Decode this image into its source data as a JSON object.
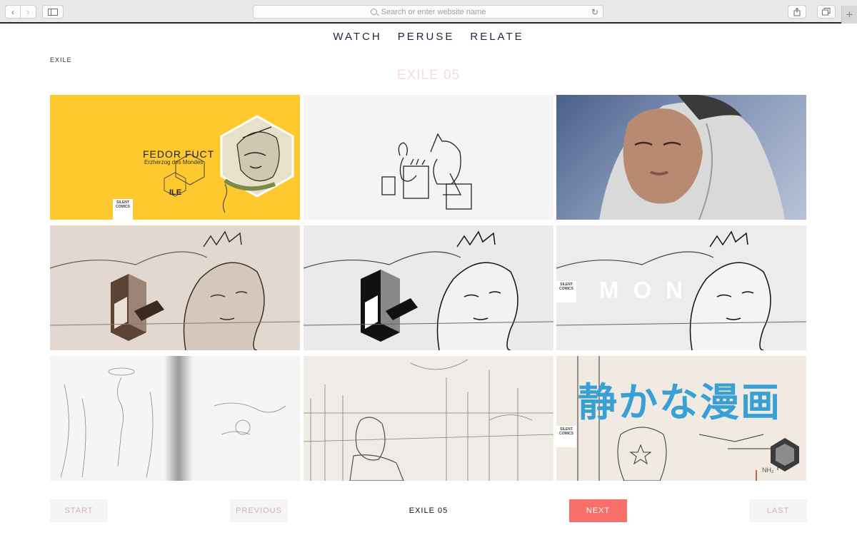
{
  "browser": {
    "address_placeholder": "Search or enter website name",
    "icons": [
      "back-icon",
      "forward-icon",
      "sidebar-icon",
      "search-icon",
      "reload-icon",
      "share-icon",
      "tabs-icon",
      "plus-icon"
    ]
  },
  "nav": {
    "items": [
      "WATCH",
      "PERUSE",
      "RELATE"
    ]
  },
  "breadcrumb": "EXILE",
  "page_title": "EXILE 05",
  "gallery": {
    "tile1": {
      "title": "FEDOR FUCT",
      "subtitle": "Erzherzog des Mondes",
      "badge": "SILENT COMICS"
    },
    "tile6": {
      "word": "MON",
      "badge": "SILENT COMICS"
    },
    "tile9": {
      "kanji": "静かな漫画",
      "badge": "SILENT COMICS"
    }
  },
  "pager": {
    "start": "START",
    "previous": "PREVIOUS",
    "current": "EXILE 05",
    "next": "NEXT",
    "last": "LAST"
  },
  "colors": {
    "accent": "#f86e68",
    "title_faded": "#f3dcdc",
    "nav_text": "#2d2240",
    "yellow_tile": "#fdc92e",
    "kanji_blue": "#39a0d4"
  }
}
